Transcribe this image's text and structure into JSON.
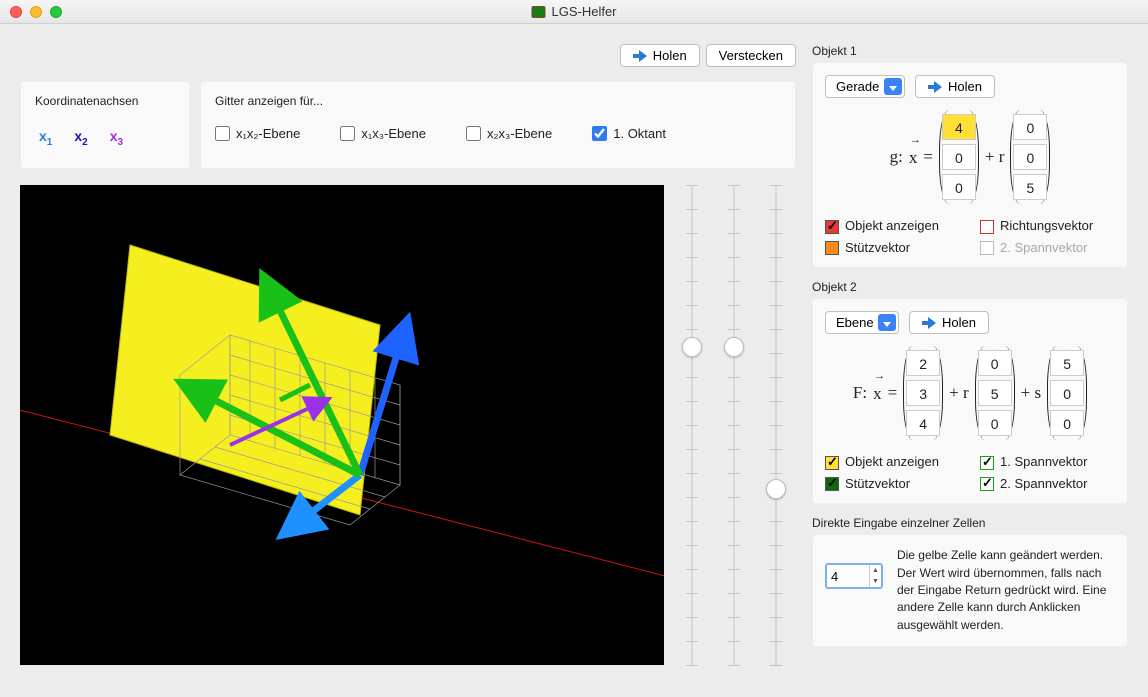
{
  "window": {
    "title": "LGS-Helfer"
  },
  "top_buttons": {
    "holen": "Holen",
    "verstecken": "Verstecken"
  },
  "axes": {
    "title": "Koordinatenachsen",
    "labels": [
      "x",
      "x",
      "x"
    ],
    "subs": [
      "1",
      "2",
      "3"
    ]
  },
  "grid": {
    "title": "Gitter anzeigen für...",
    "opts": [
      {
        "label": "x₁x₂-Ebene",
        "checked": false
      },
      {
        "label": "x₁x₃-Ebene",
        "checked": false
      },
      {
        "label": "x₂x₃-Ebene",
        "checked": false
      },
      {
        "label": "1. Oktant",
        "checked": true
      }
    ]
  },
  "obj1": {
    "header": "Objekt 1",
    "type": "Gerade",
    "holen": "Holen",
    "prefix": "g:",
    "eq": "=",
    "plus_r": "+ r",
    "p": [
      "4",
      "0",
      "0"
    ],
    "d": [
      "0",
      "0",
      "5"
    ],
    "checks": {
      "anzeigen": "Objekt anzeigen",
      "richtung": "Richtungsvektor",
      "stuetz": "Stützvektor",
      "spann2": "2. Spannvektor"
    }
  },
  "obj2": {
    "header": "Objekt 2",
    "type": "Ebene",
    "holen": "Holen",
    "prefix": "F:",
    "eq": "=",
    "plus_r": "+ r",
    "plus_s": "+ s",
    "p": [
      "2",
      "3",
      "4"
    ],
    "r": [
      "0",
      "5",
      "0"
    ],
    "s": [
      "5",
      "0",
      "0"
    ],
    "checks": {
      "anzeigen": "Objekt anzeigen",
      "spann1": "1. Spannvektor",
      "stuetz": "Stützvektor",
      "spann2": "2. Spannvektor"
    }
  },
  "direct": {
    "header": "Direkte Eingabe einzelner Zellen",
    "value": "4",
    "help": "Die gelbe Zelle kann geändert werden. Der Wert wird übernommen, falls nach der Eingabe Return gedrückt wird. Eine andere Zelle kann durch Anklicken ausgewählt werden."
  },
  "sliders": {
    "positions": [
      0.33,
      0.33,
      0.64
    ]
  }
}
